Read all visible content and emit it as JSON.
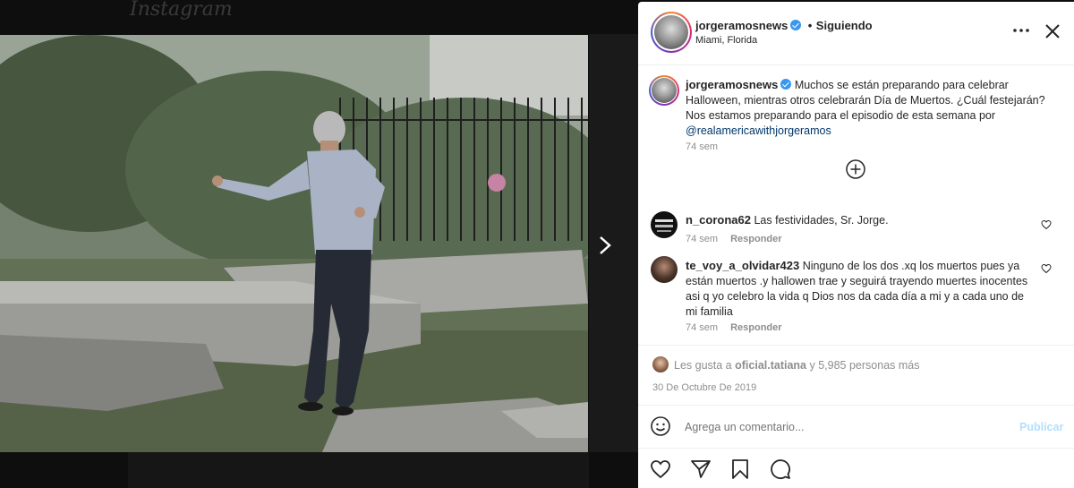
{
  "background": {
    "logo": "Instagram"
  },
  "header": {
    "username": "jorgeramosnews",
    "separator": "•",
    "follow_status": "Siguiendo",
    "location": "Miami, Florida"
  },
  "caption": {
    "username": "jorgeramosnews",
    "text": "Muchos se están preparando para celebrar Halloween, mientras otros celebrarán Día de Muertos. ¿Cuál festejarán? Nos estamos preparando para el episodio de esta semana por",
    "mention": "@realamericawithjorgeramos",
    "time": "74 sem"
  },
  "comments": [
    {
      "username": "n_corona62",
      "text": "Las festividades, Sr. Jorge.",
      "time": "74 sem",
      "reply": "Responder"
    },
    {
      "username": "te_voy_a_olvidar423",
      "text": "Ninguno de los dos .xq los muertos pues ya están muertos .y hallowen trae y seguirá trayendo muertes inocentes asi q yo celebro la vida q Dios nos da cada día a mi y a cada uno de mi familia",
      "time": "74 sem",
      "reply": "Responder"
    }
  ],
  "likes": {
    "prefix": "Les gusta a",
    "user": "oficial.tatiana",
    "suffix": "y 5,985 personas más"
  },
  "date": "30 De Octubre De 2019",
  "comment_box": {
    "placeholder": "Agrega un comentario...",
    "publish": "Publicar"
  },
  "colors": {
    "accent_link": "#00376b",
    "verified": "#3897f0",
    "publish_disabled": "#b2dffc"
  }
}
